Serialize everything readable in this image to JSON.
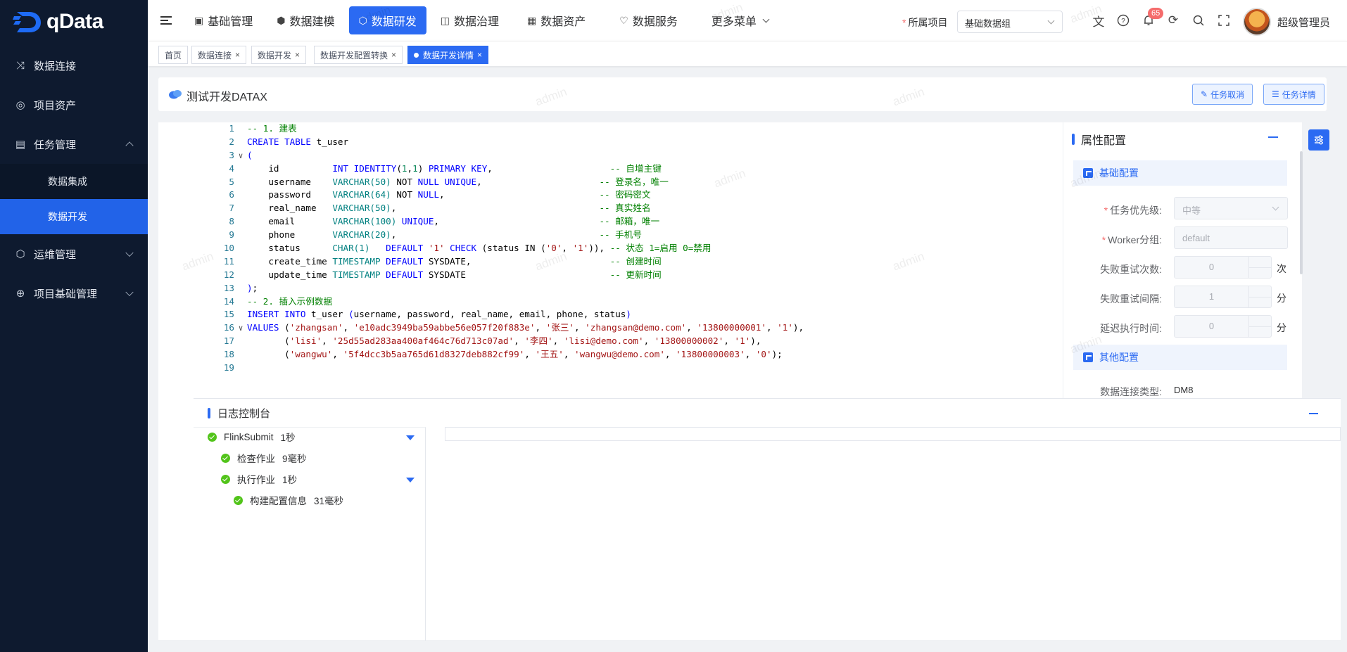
{
  "sidebar": {
    "logo_text": "qData",
    "items": [
      {
        "label": "数据连接",
        "icon": "shuffle-icon"
      },
      {
        "label": "项目资产",
        "icon": "asset-icon"
      },
      {
        "label": "任务管理",
        "icon": "doc-list-icon",
        "expanded": true,
        "children": [
          {
            "label": "数据集成"
          },
          {
            "label": "数据开发",
            "active": true
          }
        ]
      },
      {
        "label": "运维管理",
        "icon": "box-icon"
      },
      {
        "label": "项目基础管理",
        "icon": "globe-icon"
      }
    ]
  },
  "topnav": {
    "items": [
      {
        "label": "基础管理",
        "icon": "doc-icon"
      },
      {
        "label": "数据建模",
        "icon": "cube-icon"
      },
      {
        "label": "数据研发",
        "icon": "hex-icon",
        "active": true
      },
      {
        "label": "数据治理",
        "icon": "governance-icon"
      },
      {
        "label": "数据资产",
        "icon": "asset-doc-icon"
      },
      {
        "label": "数据服务",
        "icon": "heart-icon"
      },
      {
        "label": "更多菜单"
      }
    ],
    "project_label": "所属项目",
    "project_value": "基础数据组",
    "notification_count": "65",
    "user_name": "超级管理员"
  },
  "tabs": [
    {
      "label": "首页",
      "closable": false
    },
    {
      "label": "数据连接",
      "closable": true
    },
    {
      "label": "数据开发",
      "closable": true
    },
    {
      "label": "数据开发配置转换",
      "closable": true
    },
    {
      "label": "数据开发详情",
      "closable": true,
      "active": true
    }
  ],
  "header": {
    "title": "测试开发DATAX",
    "cancel_btn": "任务取消",
    "detail_btn": "任务详情"
  },
  "editor": {
    "lines": [
      [
        [
          "cm",
          "-- 1. 建表"
        ]
      ],
      [
        [
          "kw",
          "CREATE TABLE"
        ],
        [
          "pl",
          " t_user"
        ]
      ],
      [
        [
          "kw",
          "("
        ]
      ],
      [
        [
          "pl",
          "    id          "
        ],
        [
          "kw",
          "INT IDENTITY"
        ],
        [
          "pn",
          "("
        ],
        [
          "nu",
          "1"
        ],
        [
          "pn",
          ","
        ],
        [
          "nu",
          "1"
        ],
        [
          "pn",
          ") "
        ],
        [
          "kw",
          "PRIMARY KEY"
        ],
        [
          "pl",
          ",                      "
        ],
        [
          "cm",
          "-- 自增主键"
        ]
      ],
      [
        [
          "pl",
          "    username    "
        ],
        [
          "ty",
          "VARCHAR(50)"
        ],
        [
          "pl",
          " NOT "
        ],
        [
          "kw",
          "NULL"
        ],
        [
          "pl",
          " "
        ],
        [
          "kw",
          "UNIQUE"
        ],
        [
          "pl",
          ",                      "
        ],
        [
          "cm",
          "-- 登录名，唯一"
        ]
      ],
      [
        [
          "pl",
          "    password    "
        ],
        [
          "ty",
          "VARCHAR(64)"
        ],
        [
          "pl",
          " NOT "
        ],
        [
          "kw",
          "NULL"
        ],
        [
          "pl",
          ",                             "
        ],
        [
          "cm",
          "-- 密码密文"
        ]
      ],
      [
        [
          "pl",
          "    real_name   "
        ],
        [
          "ty",
          "VARCHAR(50)"
        ],
        [
          "pl",
          ",                                      "
        ],
        [
          "cm",
          "-- 真实姓名"
        ]
      ],
      [
        [
          "pl",
          "    email       "
        ],
        [
          "ty",
          "VARCHAR(100)"
        ],
        [
          "pl",
          " "
        ],
        [
          "kw",
          "UNIQUE"
        ],
        [
          "pl",
          ",                              "
        ],
        [
          "cm",
          "-- 邮箱，唯一"
        ]
      ],
      [
        [
          "pl",
          "    phone       "
        ],
        [
          "ty",
          "VARCHAR(20)"
        ],
        [
          "pl",
          ",                                      "
        ],
        [
          "cm",
          "-- 手机号"
        ]
      ],
      [
        [
          "pl",
          "    status      "
        ],
        [
          "ty",
          "CHAR(1)"
        ],
        [
          "pl",
          "   "
        ],
        [
          "kw",
          "DEFAULT"
        ],
        [
          "pl",
          " "
        ],
        [
          "st",
          "'1'"
        ],
        [
          "pl",
          " "
        ],
        [
          "kw",
          "CHECK"
        ],
        [
          "pl",
          " (status IN ("
        ],
        [
          "st",
          "'0'"
        ],
        [
          "pl",
          ", "
        ],
        [
          "st",
          "'1'"
        ],
        [
          "pl",
          ")), "
        ],
        [
          "cm",
          "-- 状态 1=启用 0=禁用"
        ]
      ],
      [
        [
          "pl",
          "    create_time "
        ],
        [
          "ty",
          "TIMESTAMP"
        ],
        [
          "pl",
          " "
        ],
        [
          "kw",
          "DEFAULT"
        ],
        [
          "pl",
          " SYSDATE,                          "
        ],
        [
          "cm",
          "-- 创建时间"
        ]
      ],
      [
        [
          "pl",
          "    update_time "
        ],
        [
          "ty",
          "TIMESTAMP"
        ],
        [
          "pl",
          " "
        ],
        [
          "kw",
          "DEFAULT"
        ],
        [
          "pl",
          " SYSDATE                           "
        ],
        [
          "cm",
          "-- 更新时间"
        ]
      ],
      [
        [
          "kw",
          ")"
        ],
        [
          "pl",
          ";"
        ]
      ],
      [
        [
          "cm",
          "-- 2. 插入示例数据"
        ]
      ],
      [
        [
          "kw",
          "INSERT INTO"
        ],
        [
          "pl",
          " t_user "
        ],
        [
          "kw",
          "("
        ],
        [
          "pl",
          "username, password, real_name, email, phone, status"
        ],
        [
          "kw",
          ")"
        ]
      ],
      [
        [
          "kw",
          "VALUES"
        ],
        [
          "pl",
          " ("
        ],
        [
          "st",
          "'zhangsan'"
        ],
        [
          "pl",
          ", "
        ],
        [
          "st",
          "'e10adc3949ba59abbe56e057f20f883e'"
        ],
        [
          "pl",
          ", "
        ],
        [
          "st",
          "'张三'"
        ],
        [
          "pl",
          ", "
        ],
        [
          "st",
          "'zhangsan@demo.com'"
        ],
        [
          "pl",
          ", "
        ],
        [
          "st",
          "'13800000001'"
        ],
        [
          "pl",
          ", "
        ],
        [
          "st",
          "'1'"
        ],
        [
          "pl",
          "),"
        ]
      ],
      [
        [
          "pl",
          "       ("
        ],
        [
          "st",
          "'lisi'"
        ],
        [
          "pl",
          ", "
        ],
        [
          "st",
          "'25d55ad283aa400af464c76d713c07ad'"
        ],
        [
          "pl",
          ", "
        ],
        [
          "st",
          "'李四'"
        ],
        [
          "pl",
          ", "
        ],
        [
          "st",
          "'lisi@demo.com'"
        ],
        [
          "pl",
          ", "
        ],
        [
          "st",
          "'13800000002'"
        ],
        [
          "pl",
          ", "
        ],
        [
          "st",
          "'1'"
        ],
        [
          "pl",
          "),"
        ]
      ],
      [
        [
          "pl",
          "       ("
        ],
        [
          "st",
          "'wangwu'"
        ],
        [
          "pl",
          ", "
        ],
        [
          "st",
          "'5f4dcc3b5aa765d61d8327deb882cf99'"
        ],
        [
          "pl",
          ", "
        ],
        [
          "st",
          "'王五'"
        ],
        [
          "pl",
          ", "
        ],
        [
          "st",
          "'wangwu@demo.com'"
        ],
        [
          "pl",
          ", "
        ],
        [
          "st",
          "'13800000003'"
        ],
        [
          "pl",
          ", "
        ],
        [
          "st",
          "'0'"
        ],
        [
          "pl",
          ");"
        ]
      ],
      []
    ],
    "fold_lines": [
      3,
      16
    ]
  },
  "props": {
    "title": "属性配置",
    "basic_section": "基础配置",
    "other_section": "其他配置",
    "priority_label": "任务优先级:",
    "priority_value": "中等",
    "worker_label": "Worker分组:",
    "worker_placeholder": "default",
    "retry_times_label": "失败重试次数:",
    "retry_times_value": "0",
    "retry_times_unit": "次",
    "retry_interval_label": "失败重试间隔:",
    "retry_interval_value": "1",
    "retry_interval_unit": "分",
    "delay_label": "延迟执行时间:",
    "delay_value": "0",
    "delay_unit": "分",
    "conn_type_label": "数据连接类型:",
    "conn_type_value": "DM8"
  },
  "log": {
    "title": "日志控制台",
    "nodes": [
      {
        "label": "FlinkSubmit",
        "duration": "1秒"
      },
      {
        "label": "检查作业",
        "duration": "9毫秒"
      },
      {
        "label": "执行作业",
        "duration": "1秒"
      },
      {
        "label": "构建配置信息",
        "duration": "31毫秒"
      }
    ]
  },
  "watermark": "admin"
}
